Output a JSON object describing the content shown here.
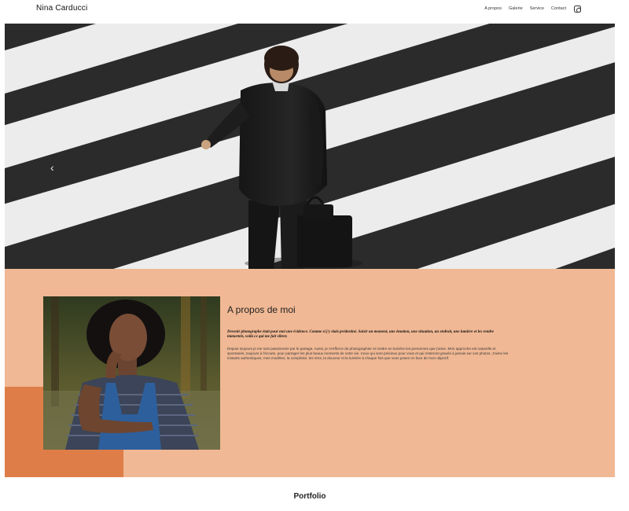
{
  "site": {
    "brand": "Nina Carducci"
  },
  "nav": {
    "items": [
      {
        "label": "A propos"
      },
      {
        "label": "Galerie"
      },
      {
        "label": "Service"
      },
      {
        "label": "Contact"
      }
    ],
    "social_icon": "instagram-icon"
  },
  "hero": {
    "prev_arrow": "‹",
    "slide_count": 3,
    "active_slide": 1
  },
  "about": {
    "title": "A propos de moi",
    "quote": "Devenir photographe était pour moi une évidence. Comme si j'y étais prédestiné. Saisir un moment, une émotion, une situation, un endroit, une lumière et les rendre immortels, voilà ce qui me fait vibrer.",
    "body": "Depuis toujours je me suis passionnée par le partage. Aussi, je m'efforce de photographier et mettre en lumière les personnes que j'aime. Mon approche est naturelle et spontanée, toujours à l'écoute, pour partager les plus beaux moments de votre vie. Ceux qui sont précieux pour vous et qui resteront gravés à jamais sur vos photos. J'aime les instants authentiques, mes modèles, la complicité, les rires, la douceur et la lumière à chaque fois que vous posez en face de mon objectif."
  },
  "portfolio": {
    "title": "Portfolio"
  },
  "colors": {
    "about_bg": "#f0b894",
    "accent": "#de7d47"
  }
}
